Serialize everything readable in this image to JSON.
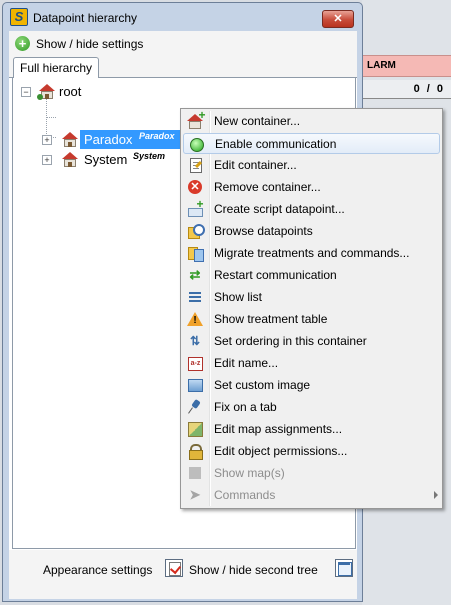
{
  "background": {
    "header_text": "ALARM",
    "header_visible": "LARM",
    "row_value": "0 / 0"
  },
  "window": {
    "title": "Datapoint hierarchy",
    "app_icon_letter": "S",
    "close_glyph": "✕"
  },
  "settings": {
    "toggle_label": "Show / hide settings"
  },
  "tabs": [
    {
      "label": "Full hierarchy",
      "active": true
    }
  ],
  "tree": {
    "root": {
      "label": "root",
      "expander": "−"
    },
    "children": [
      {
        "label": "Paradox",
        "tag": "Paradox",
        "selected": true,
        "expander": "+"
      },
      {
        "label": "System",
        "tag": "System",
        "selected": false,
        "expander": "+"
      }
    ]
  },
  "footer": {
    "appearance_label": "Appearance settings",
    "second_tree_label": "Show / hide second tree"
  },
  "context_menu": {
    "items": [
      {
        "label": "New container...",
        "icon": "new-container-icon",
        "enabled": true
      },
      {
        "label": "Enable communication",
        "icon": "green-light-icon",
        "enabled": true,
        "highlighted": true
      },
      {
        "label": "Edit container...",
        "icon": "edit-document-icon",
        "enabled": true
      },
      {
        "label": "Remove container...",
        "icon": "remove-icon",
        "enabled": true
      },
      {
        "label": "Create script datapoint...",
        "icon": "script-datapoint-icon",
        "enabled": true
      },
      {
        "label": "Browse datapoints",
        "icon": "browse-icon",
        "enabled": true
      },
      {
        "label": "Migrate treatments and commands...",
        "icon": "migrate-icon",
        "enabled": true
      },
      {
        "label": "Restart communication",
        "icon": "restart-icon",
        "enabled": true
      },
      {
        "label": "Show list",
        "icon": "list-icon",
        "enabled": true
      },
      {
        "label": "Show treatment table",
        "icon": "warning-icon",
        "enabled": true
      },
      {
        "label": "Set ordering in this container",
        "icon": "ordering-icon",
        "enabled": true
      },
      {
        "label": "Edit name...",
        "icon": "rename-icon",
        "enabled": true
      },
      {
        "label": "Set custom image",
        "icon": "image-icon",
        "enabled": true
      },
      {
        "label": "Fix on a tab",
        "icon": "pin-icon",
        "enabled": true
      },
      {
        "label": "Edit map assignments...",
        "icon": "map-icon",
        "enabled": true
      },
      {
        "label": "Edit object permissions...",
        "icon": "lock-icon",
        "enabled": true
      },
      {
        "label": "Show map(s)",
        "icon": "maps-icon",
        "enabled": false
      },
      {
        "label": "Commands",
        "icon": "commands-icon",
        "enabled": false,
        "submenu": true
      }
    ]
  },
  "colors": {
    "selection": "#3399ff",
    "alarm_header": "#f5b9b5",
    "window_frame": "#c5d3e6",
    "close_button": "#c84c3a"
  }
}
